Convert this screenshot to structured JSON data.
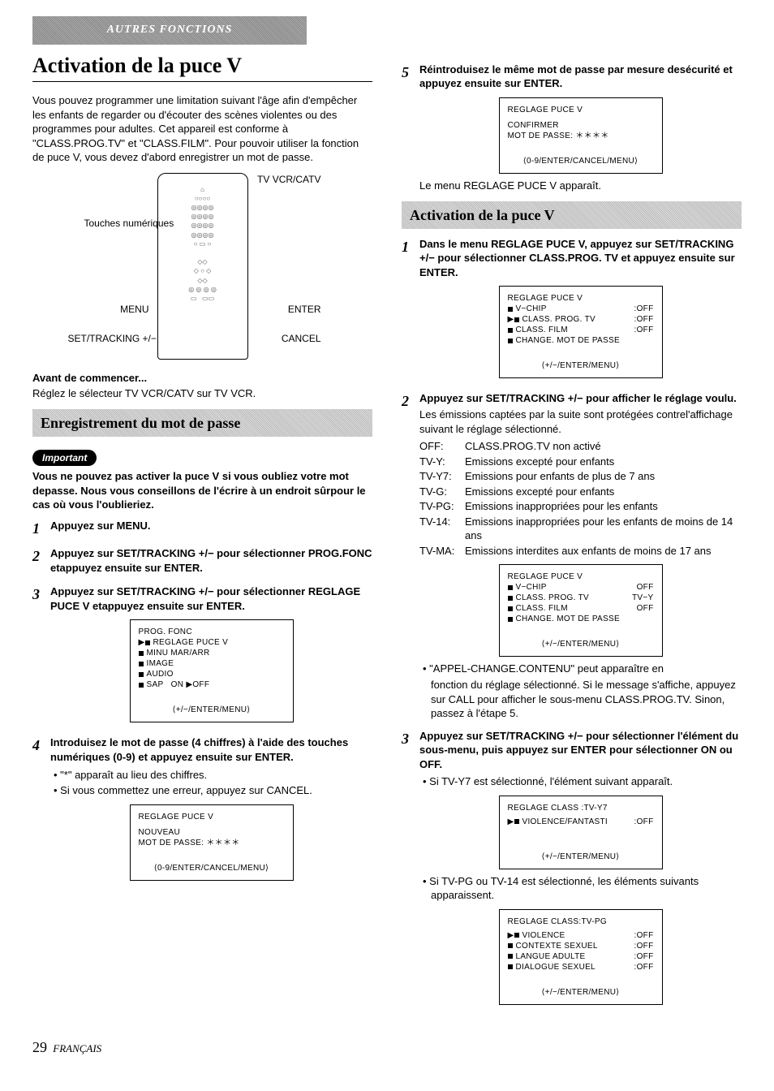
{
  "header_band": "AUTRES FONCTIONS",
  "main_title": "Activation de la puce V",
  "intro": "Vous pouvez programmer une limitation suivant l'âge afin d'empêcher les enfants de regarder ou d'écouter des scènes violentes ou des programmes pour adultes. Cet appareil est conforme à \"CLASS.PROG.TV\" et \"CLASS.FILM\". Pour pouvoir utiliser la fonction de puce V, vous devez d'abord enregistrer un mot de passe.",
  "remote": {
    "tv_vcr_catv": "TV VCR/CATV",
    "touches_num": "Touches numériques",
    "menu": "MENU",
    "set_tracking": "SET/TRACKING +/−",
    "enter": "ENTER",
    "cancel": "CANCEL"
  },
  "before_start_head": "Avant de commencer...",
  "before_start_body": "Réglez le sélecteur TV VCR/CATV sur TV VCR.",
  "section_record": "Enregistrement du mot de passe",
  "important_label": "Important",
  "important_body": "Vous ne pouvez pas activer la puce V si vous oubliez votre mot depasse. Nous vous conseillons de l'écrire à un endroit sûrpour le cas où vous l'oublieriez.",
  "left_steps": {
    "s1": "Appuyez sur MENU.",
    "s2": "Appuyez sur SET/TRACKING +/− pour sélectionner PROG.FONC etappuyez ensuite sur ENTER.",
    "s3": "Appuyez sur SET/TRACKING +/− pour sélectionner REGLAGE PUCE V etappuyez ensuite sur ENTER.",
    "s4": "Introduisez le mot de passe (4 chiffres) à l'aide des touches numériques (0-9) et appuyez ensuite sur ENTER.",
    "s4_b1": "\"*\" apparaît au lieu des chiffres.",
    "s4_b2": "Si vous commettez une erreur, appuyez sur CANCEL."
  },
  "screen1": {
    "l1": "PROG. FONC",
    "l2": "REGLAGE PUCE V",
    "l3": "MINU MAR/ARR",
    "l4": "IMAGE",
    "l5": "AUDIO",
    "l6a": "SAP",
    "l6b": "ON ▶OFF",
    "foot": "⟨+/−/ENTER/MENU⟩"
  },
  "screen2": {
    "title": "REGLAGE PUCE V",
    "l1": "NOUVEAU",
    "l2": "MOT DE PASSE: ＊＊＊＊",
    "foot": "⟨0-9/ENTER/CANCEL/MENU⟩"
  },
  "right_step5": "Réintroduisez le même mot de passe par mesure desécurité et appuyez ensuite sur ENTER.",
  "screen3": {
    "title": "REGLAGE PUCE V",
    "l1": "CONFIRMER",
    "l2": "MOT DE PASSE: ＊＊＊＊",
    "foot": "⟨0-9/ENTER/CANCEL/MENU⟩"
  },
  "menu_appears": "Le menu REGLAGE PUCE V apparaît.",
  "section_activate": "Activation de la puce V",
  "right_steps": {
    "s1": "Dans le menu REGLAGE PUCE V, appuyez sur SET/TRACKING +/− pour sélectionner CLASS.PROG. TV et appuyez ensuite sur ENTER.",
    "s2_head": "Appuyez sur SET/TRACKING +/− pour afficher le réglage voulu.",
    "s2_body": "Les émissions captées par la suite sont protégées contrel'affichage suivant le réglage sélectionné.",
    "s3": "Appuyez sur SET/TRACKING +/− pour sélectionner l'élément du sous-menu, puis appuyez sur ENTER pour sélectionner ON ou OFF.",
    "s3_b1": "Si TV-Y7 est sélectionné, l'élément suivant apparaît.",
    "s3_b2": "Si TV-PG ou TV-14 est sélectionné, les éléments suivants apparaissent."
  },
  "screen4": {
    "title": "REGLAGE PUCE V",
    "r1a": "V−CHIP",
    "r1b": ":OFF",
    "r2a": "CLASS. PROG. TV",
    "r2b": ":OFF",
    "r3a": "CLASS. FILM",
    "r3b": ":OFF",
    "r4": "CHANGE. MOT DE PASSE",
    "foot": "⟨+/−/ENTER/MENU⟩"
  },
  "ratings": {
    "off_l": "OFF:",
    "off_d": "CLASS.PROG.TV non activé",
    "tvy_l": "TV-Y:",
    "tvy_d": "Emissions excepté pour enfants",
    "tvy7_l": "TV-Y7:",
    "tvy7_d": "Emissions pour enfants de plus de 7 ans",
    "tvg_l": "TV-G:",
    "tvg_d": "Emissions excepté pour enfants",
    "tvpg_l": "TV-PG:",
    "tvpg_d": "Emissions inappropriées pour les enfants",
    "tv14_l": "TV-14:",
    "tv14_d": "Emissions inappropriées pour les enfants de moins de 14 ans",
    "tvma_l": "TV-MA:",
    "tvma_d": "Emissions interdites aux enfants de moins de 17 ans"
  },
  "screen5": {
    "title": "REGLAGE PUCE V",
    "r1a": "V−CHIP",
    "r1b": "OFF",
    "r2a": "CLASS. PROG. TV",
    "r2b": "TV−Y",
    "r3a": "CLASS. FILM",
    "r3b": "OFF",
    "r4": "CHANGE. MOT DE PASSE",
    "foot": "⟨+/−/ENTER/MENU⟩"
  },
  "appel_bullet": "\"APPEL-CHANGE.CONTENU\" peut apparaître en",
  "appel_body": "fonction du réglage sélectionné. Si le message s'affiche, appuyez sur CALL pour afficher le sous-menu CLASS.PROG.TV. Sinon, passez à l'étape 5.",
  "screen6": {
    "title": "REGLAGE CLASS :TV-Y7",
    "r1a": "VIOLENCE/FANTASTI",
    "r1b": ":OFF",
    "foot": "⟨+/−/ENTER/MENU⟩"
  },
  "screen7": {
    "title": "REGLAGE CLASS:TV-PG",
    "r1a": "VIOLENCE",
    "r1b": ":OFF",
    "r2a": "CONTEXTE SEXUEL",
    "r2b": ":OFF",
    "r3a": "LANGUE ADULTE",
    "r3b": ":OFF",
    "r4a": "DIALOGUE SEXUEL",
    "r4b": ":OFF",
    "foot": "⟨+/−/ENTER/MENU⟩"
  },
  "page_number": "29",
  "page_lang": "FRANÇAIS"
}
